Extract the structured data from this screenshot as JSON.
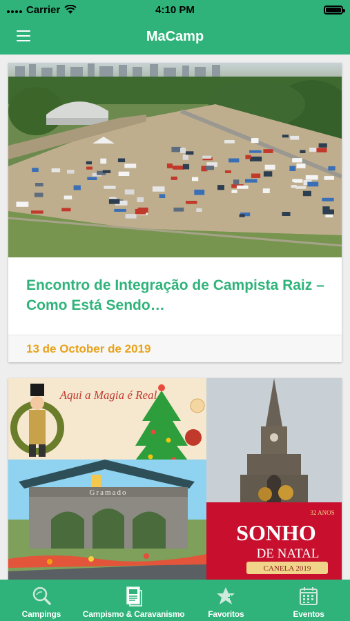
{
  "status_bar": {
    "carrier": "Carrier",
    "time": "4:10 PM"
  },
  "nav": {
    "title": "MaCamp",
    "menu_icon": "hamburger-menu-icon"
  },
  "feed": {
    "cards": [
      {
        "title": "Encontro de Integração de Campista Raiz – Como Está Sendo…",
        "date": "13 de October de 2019"
      },
      {
        "banner_top_text": "Aqui a Magia é Real",
        "gate_text": "Gramado",
        "years_text": "32 ANOS",
        "event_title_line1": "SONHO",
        "event_title_line2": "DE NATAL",
        "event_subtitle": "CANELA 2019"
      }
    ]
  },
  "tabs": [
    {
      "label": "Campings",
      "icon": "magnifier-icon"
    },
    {
      "label": "Campismo & Caravanismo",
      "icon": "document-icon"
    },
    {
      "label": "Favoritos",
      "icon": "star-icon"
    },
    {
      "label": "Eventos",
      "icon": "calendar-icon"
    }
  ],
  "colors": {
    "brand": "#2fb37a",
    "date": "#e8a21a",
    "card_bg": "#ffffff",
    "page_bg": "#eeeeee"
  }
}
